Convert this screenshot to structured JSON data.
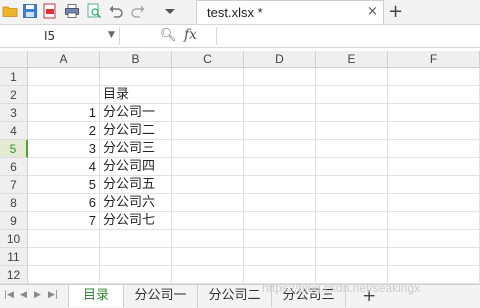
{
  "toolbar": {
    "icons": [
      "folder-icon",
      "save-icon",
      "export-pdf-icon",
      "print-icon",
      "print-preview-icon",
      "undo-icon",
      "redo-icon",
      "dropdown-icon"
    ]
  },
  "file_tab": {
    "name": "test.xlsx *",
    "close": "×"
  },
  "new_tab": "+",
  "formula_bar": {
    "name_box": "I5",
    "fx": "fx",
    "value": ""
  },
  "columns": [
    "A",
    "B",
    "C",
    "D",
    "E",
    "F"
  ],
  "rows": [
    {
      "n": "1",
      "a": "",
      "b": ""
    },
    {
      "n": "2",
      "a": "",
      "b": "目录"
    },
    {
      "n": "3",
      "a": "1",
      "b": "分公司一"
    },
    {
      "n": "4",
      "a": "2",
      "b": "分公司二"
    },
    {
      "n": "5",
      "a": "3",
      "b": "分公司三"
    },
    {
      "n": "6",
      "a": "4",
      "b": "分公司四"
    },
    {
      "n": "7",
      "a": "5",
      "b": "分公司五"
    },
    {
      "n": "8",
      "a": "6",
      "b": "分公司六"
    },
    {
      "n": "9",
      "a": "7",
      "b": "分公司七"
    },
    {
      "n": "10",
      "a": "",
      "b": ""
    },
    {
      "n": "11",
      "a": "",
      "b": ""
    },
    {
      "n": "12",
      "a": "",
      "b": ""
    }
  ],
  "active_row": "5",
  "sheets": [
    "目录",
    "分公司一",
    "分公司二",
    "分公司三"
  ],
  "active_sheet": "目录",
  "add_sheet": "+",
  "watermark": "https://blog.csdn.net/seakingx",
  "colors": {
    "accent_green": "#59a23a",
    "active_tab_text": "#2f8a2f"
  }
}
